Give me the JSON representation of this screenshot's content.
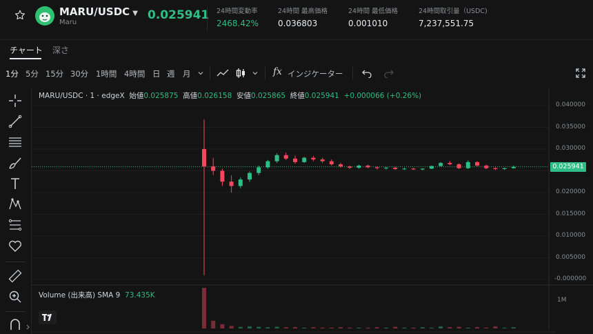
{
  "header": {
    "pair": "MARU/USDC",
    "subtitle": "Maru",
    "price": "0.025941",
    "stats": [
      {
        "label": "24時間変動率",
        "value": "2468.42%",
        "color": "green"
      },
      {
        "label": "24時間 最高価格",
        "value": "0.036803",
        "color": "white"
      },
      {
        "label": "24時間 最低価格",
        "value": "0.001010",
        "color": "white"
      },
      {
        "label": "24時間取引量（USDC)",
        "value": "7,237,551.75",
        "color": "white"
      }
    ]
  },
  "tabs": [
    {
      "label": "チャート",
      "active": true
    },
    {
      "label": "深さ",
      "active": false
    }
  ],
  "toolbar": {
    "intervals": [
      "1分",
      "5分",
      "15分",
      "30分",
      "1時間",
      "4時間",
      "日",
      "週",
      "月"
    ],
    "active_interval": "1分",
    "indicator_label": "インジケーター",
    "fx_label": "fx"
  },
  "legend": {
    "symbol": "MARU/USDC · 1 · edgeX",
    "open_label": "始値",
    "open": "0.025875",
    "high_label": "高値",
    "high": "0.026158",
    "low_label": "安値",
    "low": "0.025865",
    "close_label": "終値",
    "close": "0.025941",
    "change": "+0.000066 (+0.26%)"
  },
  "price_axis": {
    "ticks": [
      "0.040000",
      "0.035000",
      "0.030000",
      "0.025000",
      "0.020000",
      "0.015000",
      "0.010000",
      "0.005000",
      "-0.000000"
    ],
    "current": "0.025941"
  },
  "volume": {
    "label": "Volume (出来高) SMA 9",
    "value": "73.435K",
    "axis_tick": "1M"
  },
  "colors": {
    "up": "#2ebd85",
    "down": "#f6465d",
    "bg": "#141414"
  },
  "chart_data": {
    "type": "candlestick",
    "ylim": [
      0,
      0.04
    ],
    "current_price": 0.025941,
    "series": [
      {
        "values": [
          [
            0.03,
            0.0368,
            0.001,
            0.026
          ],
          [
            0.026,
            0.028,
            0.024,
            0.025
          ],
          [
            0.025,
            0.0255,
            0.0215,
            0.0225
          ],
          [
            0.0225,
            0.024,
            0.02,
            0.0215
          ],
          [
            0.0215,
            0.0235,
            0.021,
            0.023
          ],
          [
            0.023,
            0.0248,
            0.0225,
            0.0245
          ],
          [
            0.0245,
            0.0262,
            0.024,
            0.0258
          ],
          [
            0.0258,
            0.0275,
            0.0255,
            0.0272
          ],
          [
            0.0272,
            0.029,
            0.0268,
            0.0286
          ],
          [
            0.0286,
            0.0292,
            0.0275,
            0.0278
          ],
          [
            0.0278,
            0.0285,
            0.0266,
            0.027
          ],
          [
            0.027,
            0.0282,
            0.0268,
            0.028
          ],
          [
            0.028,
            0.0284,
            0.0272,
            0.0276
          ],
          [
            0.0276,
            0.028,
            0.0268,
            0.0272
          ],
          [
            0.0272,
            0.0276,
            0.0262,
            0.0265
          ],
          [
            0.0265,
            0.0268,
            0.0257,
            0.026
          ],
          [
            0.026,
            0.0262,
            0.0254,
            0.0257
          ],
          [
            0.0257,
            0.0264,
            0.0255,
            0.0262
          ],
          [
            0.0262,
            0.0264,
            0.0256,
            0.0258
          ],
          [
            0.0258,
            0.026,
            0.0253,
            0.0256
          ],
          [
            0.0256,
            0.0259,
            0.0253,
            0.0257
          ],
          [
            0.0257,
            0.0259,
            0.0252,
            0.0254
          ],
          [
            0.0254,
            0.0257,
            0.0252,
            0.0255
          ],
          [
            0.0255,
            0.0257,
            0.0252,
            0.0253
          ],
          [
            0.0253,
            0.0256,
            0.0251,
            0.0255
          ],
          [
            0.0255,
            0.0262,
            0.0254,
            0.0261
          ],
          [
            0.0261,
            0.027,
            0.026,
            0.0268
          ],
          [
            0.0268,
            0.0272,
            0.0263,
            0.0265
          ],
          [
            0.0265,
            0.0267,
            0.0254,
            0.0256
          ],
          [
            0.0256,
            0.0274,
            0.0254,
            0.027
          ],
          [
            0.027,
            0.0272,
            0.026,
            0.0262
          ],
          [
            0.0262,
            0.0264,
            0.0254,
            0.0256
          ],
          [
            0.0256,
            0.0258,
            0.0252,
            0.0254
          ],
          [
            0.0254,
            0.0257,
            0.0252,
            0.0256
          ],
          [
            0.0256,
            0.0262,
            0.0255,
            0.0259
          ]
        ]
      }
    ],
    "volumes": [
      0.95,
      0.18,
      0.1,
      0.06,
      0.04,
      0.05,
      0.04,
      0.03,
      0.04,
      0.03,
      0.03,
      0.02,
      0.03,
      0.02,
      0.02,
      0.03,
      0.02,
      0.02,
      0.02,
      0.03,
      0.02,
      0.04,
      0.02,
      0.02,
      0.03,
      0.02,
      0.05,
      0.03,
      0.04,
      0.02,
      0.03,
      0.02,
      0.05,
      0.02,
      0.03
    ]
  }
}
